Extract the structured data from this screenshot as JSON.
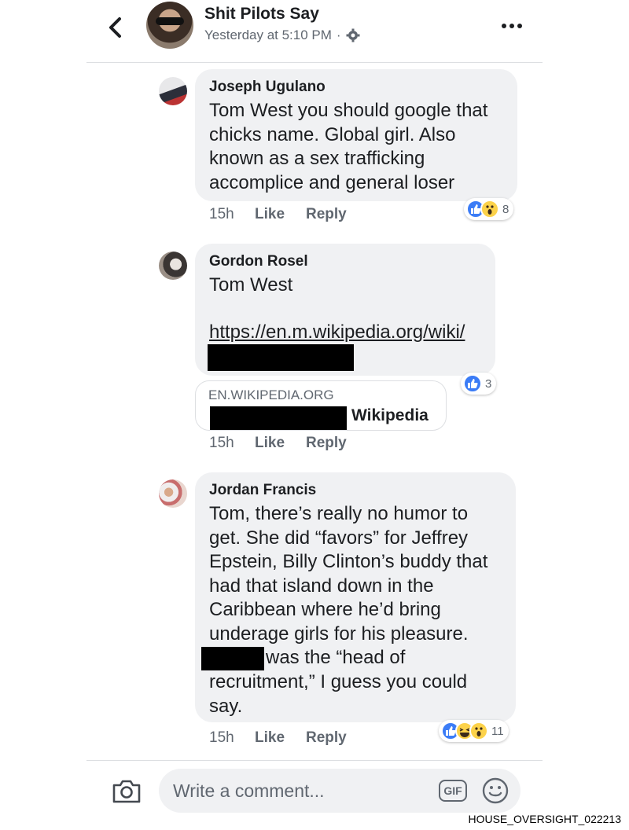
{
  "header": {
    "title": "Shit Pilots Say",
    "timestamp": "Yesterday at 5:10 PM",
    "separator": "·"
  },
  "comments": [
    {
      "author": "Joseph Ugulano",
      "text": "Tom West you should google that\nchicks name. Global girl. Also\nknown as a sex trafficking\naccomplice and general loser",
      "time": "15h",
      "like_label": "Like",
      "reply_label": "Reply",
      "reactions": [
        "like",
        "wow"
      ],
      "reaction_count": "8"
    },
    {
      "author": "Gordon Rosel",
      "text": "Tom West",
      "link": "https://en.m.wikipedia.org/wiki/",
      "preview_domain": "EN.WIKIPEDIA.ORG",
      "preview_title": "Wikipedia",
      "time": "15h",
      "like_label": "Like",
      "reply_label": "Reply",
      "reactions": [
        "like"
      ],
      "reaction_count": "3"
    },
    {
      "author": "Jordan Francis",
      "text": "Tom, there’s really no humor to\nget. She did “favors” for Jeffrey\nEpstein, Billy Clinton’s buddy that\nhad that island down in the\nCaribbean where he’d bring\nunderage girls for his pleasure.",
      "text_after_redaction": "was the “head of",
      "text_end": "recruitment,” I guess you could\nsay.",
      "time": "15h",
      "like_label": "Like",
      "reply_label": "Reply",
      "reactions": [
        "like",
        "haha",
        "wow"
      ],
      "reaction_count": "11"
    }
  ],
  "composer": {
    "placeholder": "Write a comment...",
    "gif_label": "GIF"
  },
  "footer_stamp": "HOUSE_OVERSIGHT_022213",
  "colors": {
    "accent": "#3b7cf6",
    "bubble": "#f0f1f3",
    "meta": "#606770"
  }
}
